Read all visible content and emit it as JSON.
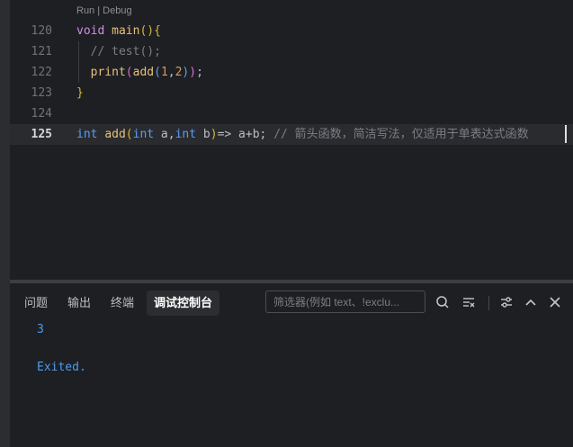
{
  "editor": {
    "codelens": "Run | Debug",
    "lines": [
      {
        "num": "120",
        "tokens": [
          {
            "t": "void",
            "c": "kw"
          },
          {
            "t": " ",
            "c": "pl"
          },
          {
            "t": "main",
            "c": "fn"
          },
          {
            "t": "(){",
            "c": "par"
          }
        ]
      },
      {
        "num": "121",
        "tokens": [
          {
            "t": "  // test();",
            "c": "cm"
          }
        ]
      },
      {
        "num": "122",
        "tokens": [
          {
            "t": "  ",
            "c": "pl"
          },
          {
            "t": "print",
            "c": "fn"
          },
          {
            "t": "(",
            "c": "par2"
          },
          {
            "t": "add",
            "c": "fn"
          },
          {
            "t": "(",
            "c": "ty"
          },
          {
            "t": "1",
            "c": "num"
          },
          {
            "t": ",",
            "c": "pl"
          },
          {
            "t": "2",
            "c": "num"
          },
          {
            "t": ")",
            "c": "ty"
          },
          {
            "t": ")",
            "c": "par2"
          },
          {
            "t": ";",
            "c": "pl"
          }
        ]
      },
      {
        "num": "123",
        "tokens": [
          {
            "t": "}",
            "c": "par"
          }
        ]
      },
      {
        "num": "124",
        "tokens": []
      },
      {
        "num": "125",
        "current": true,
        "tokens": [
          {
            "t": "int",
            "c": "ty"
          },
          {
            "t": " ",
            "c": "pl"
          },
          {
            "t": "add",
            "c": "fn"
          },
          {
            "t": "(",
            "c": "par"
          },
          {
            "t": "int",
            "c": "ty"
          },
          {
            "t": " a,",
            "c": "pl"
          },
          {
            "t": "int",
            "c": "ty"
          },
          {
            "t": " b",
            "c": "pl"
          },
          {
            "t": ")",
            "c": "par"
          },
          {
            "t": "=> a+b; ",
            "c": "pl"
          },
          {
            "t": "// 箭头函数，简洁写法，仅适用于单表达式函数",
            "c": "cm"
          }
        ]
      }
    ]
  },
  "panel": {
    "tabs": [
      {
        "label": "问题",
        "active": false
      },
      {
        "label": "输出",
        "active": false
      },
      {
        "label": "终端",
        "active": false
      },
      {
        "label": "调试控制台",
        "active": true
      }
    ],
    "filter_placeholder": "筛选器(例如 text、!exclu...",
    "output_lines": [
      "3",
      "Exited."
    ]
  }
}
